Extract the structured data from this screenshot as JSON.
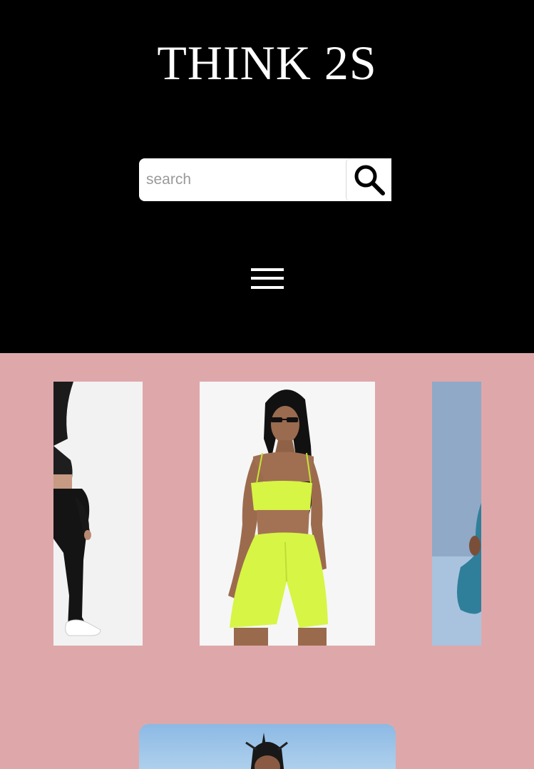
{
  "header": {
    "brand": "THINK 2S",
    "search": {
      "placeholder": "search",
      "value": ""
    },
    "menu_icon": "hamburger-menu-icon",
    "search_icon": "search-icon"
  },
  "colors": {
    "header_bg": "#000000",
    "content_bg": "#dea8aa",
    "neon_outfit": "#d7f545"
  },
  "carousel": {
    "slides": [
      {
        "name": "black-activewear-slide",
        "visible": "partial"
      },
      {
        "name": "neon-biker-set-slide",
        "visible": "center"
      },
      {
        "name": "teal-leggings-slide",
        "visible": "partial"
      }
    ]
  },
  "featured": {
    "name": "sky-photo-card"
  }
}
